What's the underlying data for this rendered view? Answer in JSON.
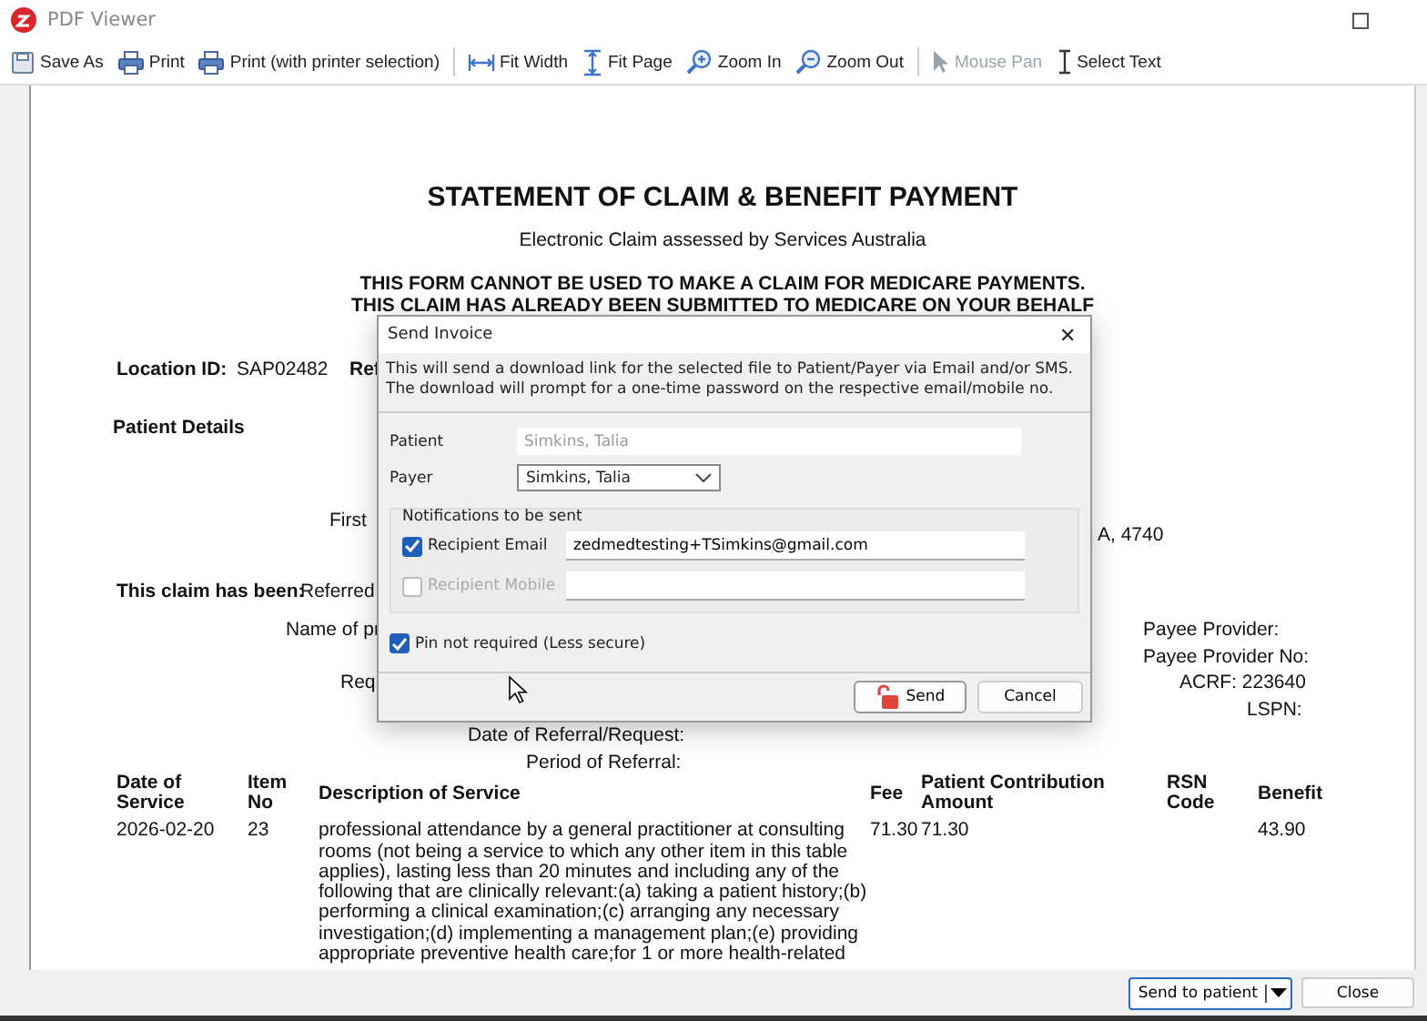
{
  "window": {
    "title": "PDF Viewer"
  },
  "toolbar": {
    "groups": [
      [
        {
          "kind": "save",
          "label": "Save As",
          "disabled": false
        },
        {
          "kind": "print",
          "label": "Print",
          "disabled": false
        },
        {
          "kind": "print",
          "label": "Print (with printer selection)",
          "disabled": false
        }
      ],
      [
        {
          "kind": "fit-width",
          "label": "Fit Width",
          "disabled": false
        },
        {
          "kind": "fit-page",
          "label": "Fit Page",
          "disabled": false
        },
        {
          "kind": "zoom-in",
          "label": "Zoom In",
          "disabled": false
        },
        {
          "kind": "zoom-out",
          "label": "Zoom Out",
          "disabled": false
        }
      ],
      [
        {
          "kind": "pointer",
          "label": "Mouse Pan",
          "disabled": true
        },
        {
          "kind": "text-cursor",
          "label": "Select Text",
          "disabled": false
        }
      ]
    ]
  },
  "document": {
    "title": "STATEMENT OF CLAIM & BENEFIT PAYMENT",
    "subtitle": "Electronic Claim assessed by Services Australia",
    "warning": "THIS FORM CANNOT BE USED TO MAKE A CLAIM FOR MEDICARE PAYMENTS.",
    "warning_2": "THIS CLAIM HAS ALREADY BEEN SUBMITTED TO MEDICARE ON YOUR BEHALF",
    "fields": [
      {
        "kind": "label",
        "text": "Location ID:"
      },
      {
        "kind": "value",
        "text": "SAP02482"
      },
      {
        "kind": "label",
        "text": "Ref"
      },
      {
        "kind": "label",
        "text": "Patient Details"
      },
      {
        "kind": "value",
        "text": "First"
      },
      {
        "kind": "value",
        "text": "A, 4740"
      },
      {
        "kind": "label",
        "text": "This claim has been:"
      },
      {
        "kind": "value",
        "text": "Referred"
      },
      {
        "kind": "value",
        "text": "Name of pr"
      },
      {
        "kind": "value",
        "text": "Req"
      },
      {
        "kind": "value",
        "text": "Payee Provider:"
      },
      {
        "kind": "value",
        "text": "Payee Provider No:"
      },
      {
        "kind": "value",
        "text": "ACRF: 223640"
      },
      {
        "kind": "value",
        "text": "LSPN:"
      },
      {
        "kind": "value",
        "text": "Date of Referral/Request:"
      },
      {
        "kind": "value",
        "text": "Period of Referral:"
      }
    ],
    "table": {
      "columns": [
        "Date of Service",
        "Item No",
        "Description of Service",
        "Fee",
        "Patient Contribution Amount",
        "RSN Code",
        "Benefit"
      ],
      "rows": [
        [
          "2026-02-20",
          "23",
          "professional attendance by a general practitioner at consulting rooms (not being a service to which any other item in this table applies), lasting less than 20 minutes and including any of the following that are clinically relevant:(a) taking a patient history;(b) performing a clinical examination;(c) arranging any necessary investigation;(d) implementing a management plan;(e) providing appropriate preventive health care;for 1 or more health-related",
          "71.30",
          "71.30",
          "",
          "43.90"
        ]
      ]
    }
  },
  "dialog": {
    "title": "Send Invoice",
    "close": "✕",
    "message": "This will send a download link for the selected file to Patient/Payer via Email and/or SMS. The download will prompt for a one-time password on the respective email/mobile no.",
    "patient": {
      "label": "Patient",
      "value": "Simkins, Talia",
      "disabled": true
    },
    "payer": {
      "label": "Payer",
      "value": "Simkins, Talia"
    },
    "notifications": {
      "title": "Notifications to be sent",
      "rows": [
        {
          "label": "Recipient Email",
          "checked": true,
          "disabled": false,
          "value": "zedmedtesting+TSimkins@gmail.com"
        },
        {
          "label": "Recipient Mobile",
          "checked": false,
          "disabled": true
        }
      ]
    },
    "pin": {
      "label": "Pin not required (Less secure)",
      "checked": true
    },
    "buttons": [
      {
        "label": "Send",
        "kind": "send",
        "default": true
      },
      {
        "label": "Cancel",
        "kind": "cancel",
        "default": false
      }
    ]
  },
  "footer": {
    "buttons": [
      {
        "label": "Send to patient",
        "kind": "split"
      },
      {
        "label": "Close",
        "kind": "plain"
      }
    ]
  }
}
